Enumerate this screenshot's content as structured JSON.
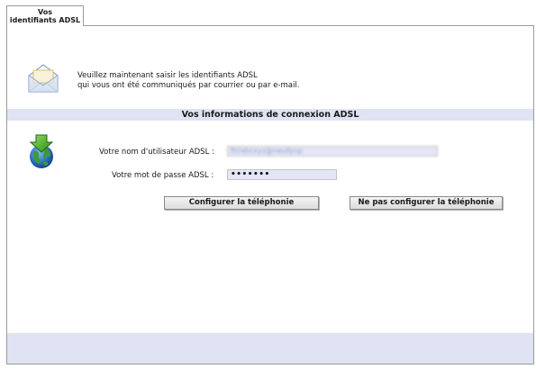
{
  "tab": {
    "line1": "Vos",
    "line2": "identifiants ADSL"
  },
  "intro": {
    "line1": "Veuillez maintenant saisir les identifiants ADSL",
    "line2": "qui vous ont été communiqués par courrier ou par e-mail.",
    "icon": "envelope-icon"
  },
  "section": {
    "title": "Vos informations de connexion ADSL",
    "icon": "globe-download-icon"
  },
  "form": {
    "username_label": "Votre nom d'utilisateur ADSL :",
    "username_value": "fti/abcxyz@neufpnp",
    "password_label": "Votre mot de passe ADSL :",
    "password_value": "•••••••"
  },
  "buttons": {
    "configure": "Configurer la téléphonie",
    "skip": "Ne pas configurer la téléphonie"
  },
  "colors": {
    "band": "#dfe3f3",
    "field": "#e4e6f6",
    "border": "#9a9a9a"
  }
}
